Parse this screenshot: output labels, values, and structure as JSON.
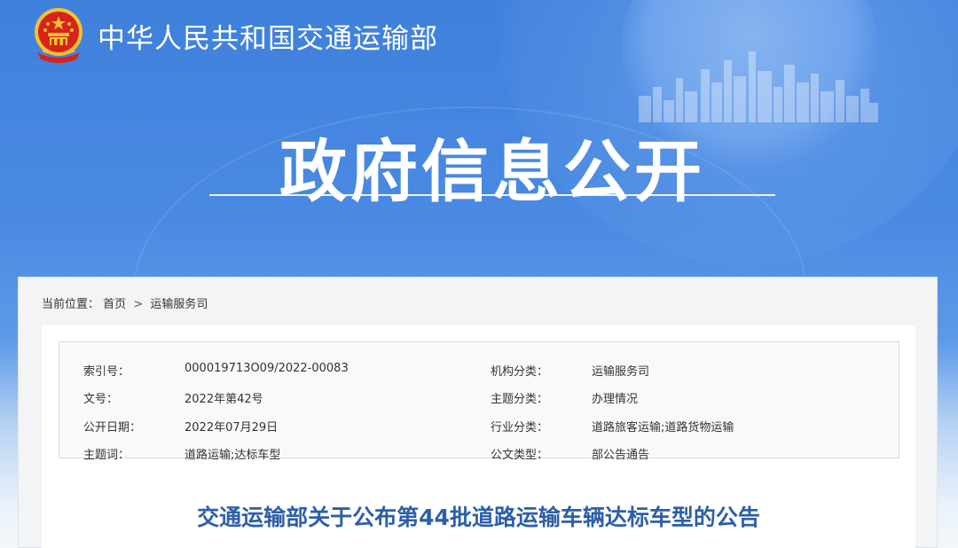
{
  "header": {
    "ministry_name": "中华人民共和国交通运输部",
    "hero_title": "政府信息公开"
  },
  "breadcrumb": {
    "label": "当前位置：",
    "items": [
      "首页",
      "运输服务司"
    ],
    "separator": ">"
  },
  "meta": {
    "rows": [
      {
        "k1": "索引号：",
        "v1": "000019713O09/2022-00083",
        "k2": "机构分类：",
        "v2": "运输服务司"
      },
      {
        "k1": "文号：",
        "v1": "2022年第42号",
        "k2": "主题分类：",
        "v2": "办理情况"
      },
      {
        "k1": "公开日期：",
        "v1": "2022年07月29日",
        "k2": "行业分类：",
        "v2": "道路旅客运输;道路货物运输"
      },
      {
        "k1": "主题词：",
        "v1": "道路运输;达标车型",
        "k2": "公文类型：",
        "v2": "部公告通告"
      }
    ]
  },
  "document": {
    "title": "交通运输部关于公布第44批道路运输车辆达标车型的公告"
  },
  "colors": {
    "banner_blue": "#4a8ae2",
    "title_blue": "#2d5fa8",
    "emblem_red": "#d7231b",
    "emblem_gold": "#f2c230"
  },
  "icons": {
    "emblem": "national-emblem-icon",
    "skyline": "city-skyline-graphic"
  }
}
